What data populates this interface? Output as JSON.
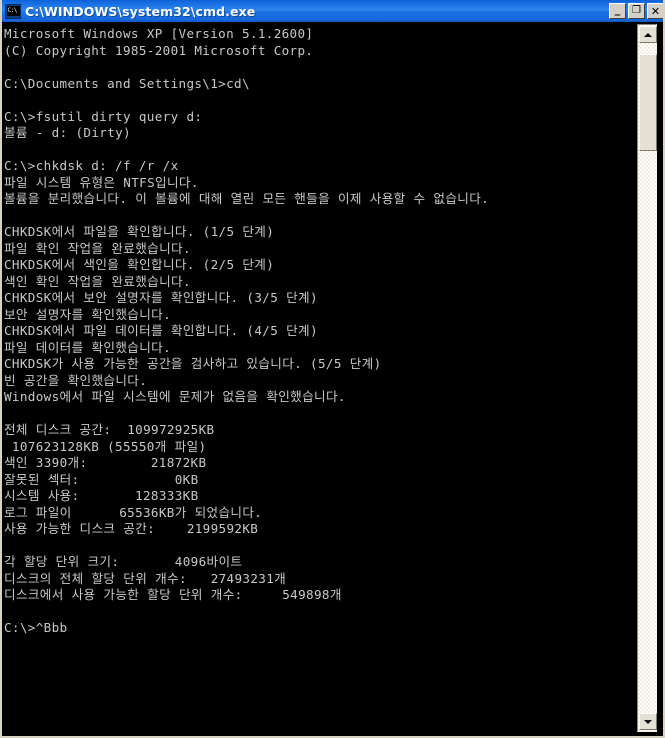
{
  "window": {
    "title": "C:\\WINDOWS\\system32\\cmd.exe",
    "icon_name": "console-icon",
    "icon_glyph": "C:\\",
    "buttons": {
      "minimize_label": "_",
      "restore_label": "❐",
      "close_label": "✕"
    },
    "colors": {
      "titlebar_active": "#1b72e4",
      "console_background": "#000000",
      "console_text": "#c8c8c8",
      "scrollbar_face": "#e4e1d4"
    }
  },
  "console": {
    "lines": [
      "Microsoft Windows XP [Version 5.1.2600]",
      "(C) Copyright 1985-2001 Microsoft Corp.",
      "",
      "C:\\Documents and Settings\\1>cd\\",
      "",
      "C:\\>fsutil dirty query d:",
      "볼륨 - d: (Dirty)",
      "",
      "C:\\>chkdsk d: /f /r /x",
      "파일 시스템 유형은 NTFS입니다.",
      "볼륨을 분리했습니다. 이 볼륨에 대해 열린 모든 핸들을 이제 사용할 수 없습니다.",
      "",
      "CHKDSK에서 파일을 확인합니다. (1/5 단계)",
      "파일 확인 작업을 완료했습니다.",
      "CHKDSK에서 색인을 확인합니다. (2/5 단계)",
      "색인 확인 작업을 완료했습니다.",
      "CHKDSK에서 보안 설명자를 확인합니다. (3/5 단계)",
      "보안 설명자를 확인했습니다.",
      "CHKDSK에서 파일 데이터를 확인합니다. (4/5 단계)",
      "파일 데이터를 확인했습니다.",
      "CHKDSK가 사용 가능한 공간을 검사하고 있습니다. (5/5 단계)",
      "빈 공간을 확인했습니다.",
      "Windows에서 파일 시스템에 문제가 없음을 확인했습니다.",
      "",
      "전체 디스크 공간:  109972925KB",
      " 107623128KB (55550개 파일)",
      "색인 3390개:        21872KB",
      "잘못된 섹터:            0KB",
      "시스템 사용:       128333KB",
      "로그 파일이      65536KB가 되었습니다.",
      "사용 가능한 디스크 공간:    2199592KB",
      "",
      "각 할당 단위 크기:       4096바이트",
      "디스크의 전체 할당 단위 개수:   27493231개",
      "디스크에서 사용 가능한 할당 단위 개수:     549898개",
      "",
      "C:\\>^Bbb"
    ]
  },
  "scrollbar": {
    "up_arrow_name": "scroll-up-arrow",
    "down_arrow_name": "scroll-down-arrow",
    "thumb_name": "scroll-thumb"
  }
}
